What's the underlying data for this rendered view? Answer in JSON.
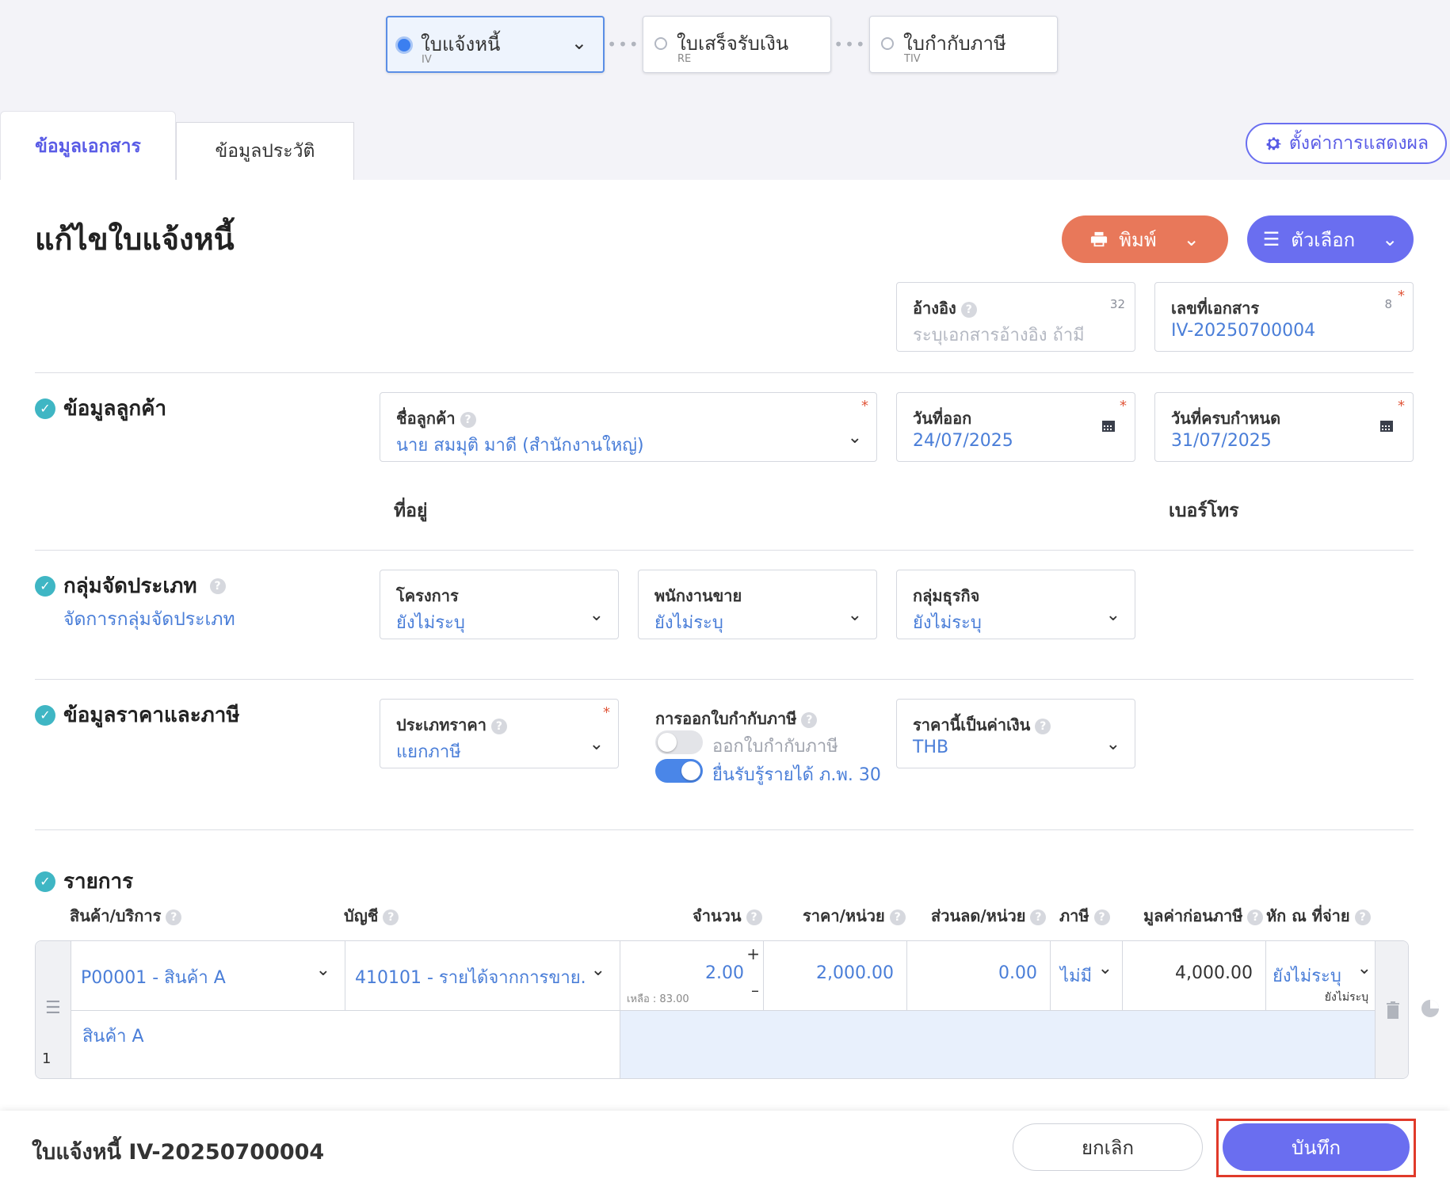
{
  "steps": [
    {
      "name": "ใบแจ้งหนี้",
      "code": "IV"
    },
    {
      "name": "ใบเสร็จรับเงิน",
      "code": "RE"
    },
    {
      "name": "ใบกำกับภาษี",
      "code": "TIV"
    }
  ],
  "tabs": {
    "document": "ข้อมูลเอกสาร",
    "history": "ข้อมูลประวัติ"
  },
  "display_settings": "ตั้งค่าการแสดงผล",
  "page_title": "แก้ไขใบแจ้งหนี้",
  "actions": {
    "print": "พิมพ์",
    "options": "ตัวเลือก"
  },
  "reference": {
    "label": "อ้างอิง",
    "count": "32",
    "placeholder": "ระบุเอกสารอ้างอิง ถ้ามี"
  },
  "doc_number": {
    "label": "เลขที่เอกสาร",
    "count": "8",
    "value": "IV-20250700004"
  },
  "customer_section": {
    "title": "ข้อมูลลูกค้า",
    "customer_name": {
      "label": "ชื่อลูกค้า",
      "value": "นาย สมมุติ มาดี (สำนักงานใหญ่)"
    },
    "issue_date": {
      "label": "วันที่ออก",
      "value": "24/07/2025"
    },
    "due_date": {
      "label": "วันที่ครบกำหนด",
      "value": "31/07/2025"
    },
    "address_label": "ที่อยู่",
    "phone_label": "เบอร์โทร"
  },
  "group_section": {
    "title": "กลุ่มจัดประเภท",
    "link": "จัดการกลุ่มจัดประเภท",
    "project": {
      "label": "โครงการ",
      "value": "ยังไม่ระบุ"
    },
    "salesperson": {
      "label": "พนักงานขาย",
      "value": "ยังไม่ระบุ"
    },
    "business_group": {
      "label": "กลุ่มธุรกิจ",
      "value": "ยังไม่ระบุ"
    }
  },
  "price_section": {
    "title": "ข้อมูลราคาและภาษี",
    "price_type": {
      "label": "ประเภทราคา",
      "value": "แยกภาษี"
    },
    "tax_invoice": {
      "label": "การออกใบกำกับภาษี",
      "toggles": [
        {
          "label": "ออกใบกำกับภาษี",
          "on": false
        },
        {
          "label": "ยื่นรับรู้รายได้ ภ.พ. 30",
          "on": true
        }
      ]
    },
    "currency": {
      "label": "ราคานี้เป็นค่าเงิน",
      "value": "THB"
    }
  },
  "items_section": {
    "title": "รายการ",
    "headers": {
      "product": "สินค้า/บริการ",
      "account": "บัญชี",
      "qty": "จำนวน",
      "unit_price": "ราคา/หน่วย",
      "discount": "ส่วนลด/หน่วย",
      "tax": "ภาษี",
      "pre_tax": "มูลค่าก่อนภาษี",
      "withholding": "หัก ณ ที่จ่าย"
    },
    "rows": [
      {
        "index": "1",
        "product": "P00001 - สินค้า A",
        "account": "410101 - รายได้จากการขาย...",
        "qty": "2.00",
        "remaining": "เหลือ : 83.00",
        "unit_price": "2,000.00",
        "discount": "0.00",
        "tax": "ไม่มี",
        "pre_tax": "4,000.00",
        "withholding": "ยังไม่ระบุ",
        "withholding_sub": "ยังไม่ระบุ",
        "description": "สินค้า A"
      }
    ]
  },
  "footer": {
    "doc_label": "ใบแจ้งหนี้ IV-20250700004",
    "cancel": "ยกเลิก",
    "save": "บันทึก"
  },
  "colors": {
    "accent": "#6a6ef0",
    "print": "#e8785a",
    "link": "#4a7ed8",
    "required": "#e0563a",
    "check": "#3fb6c4"
  }
}
